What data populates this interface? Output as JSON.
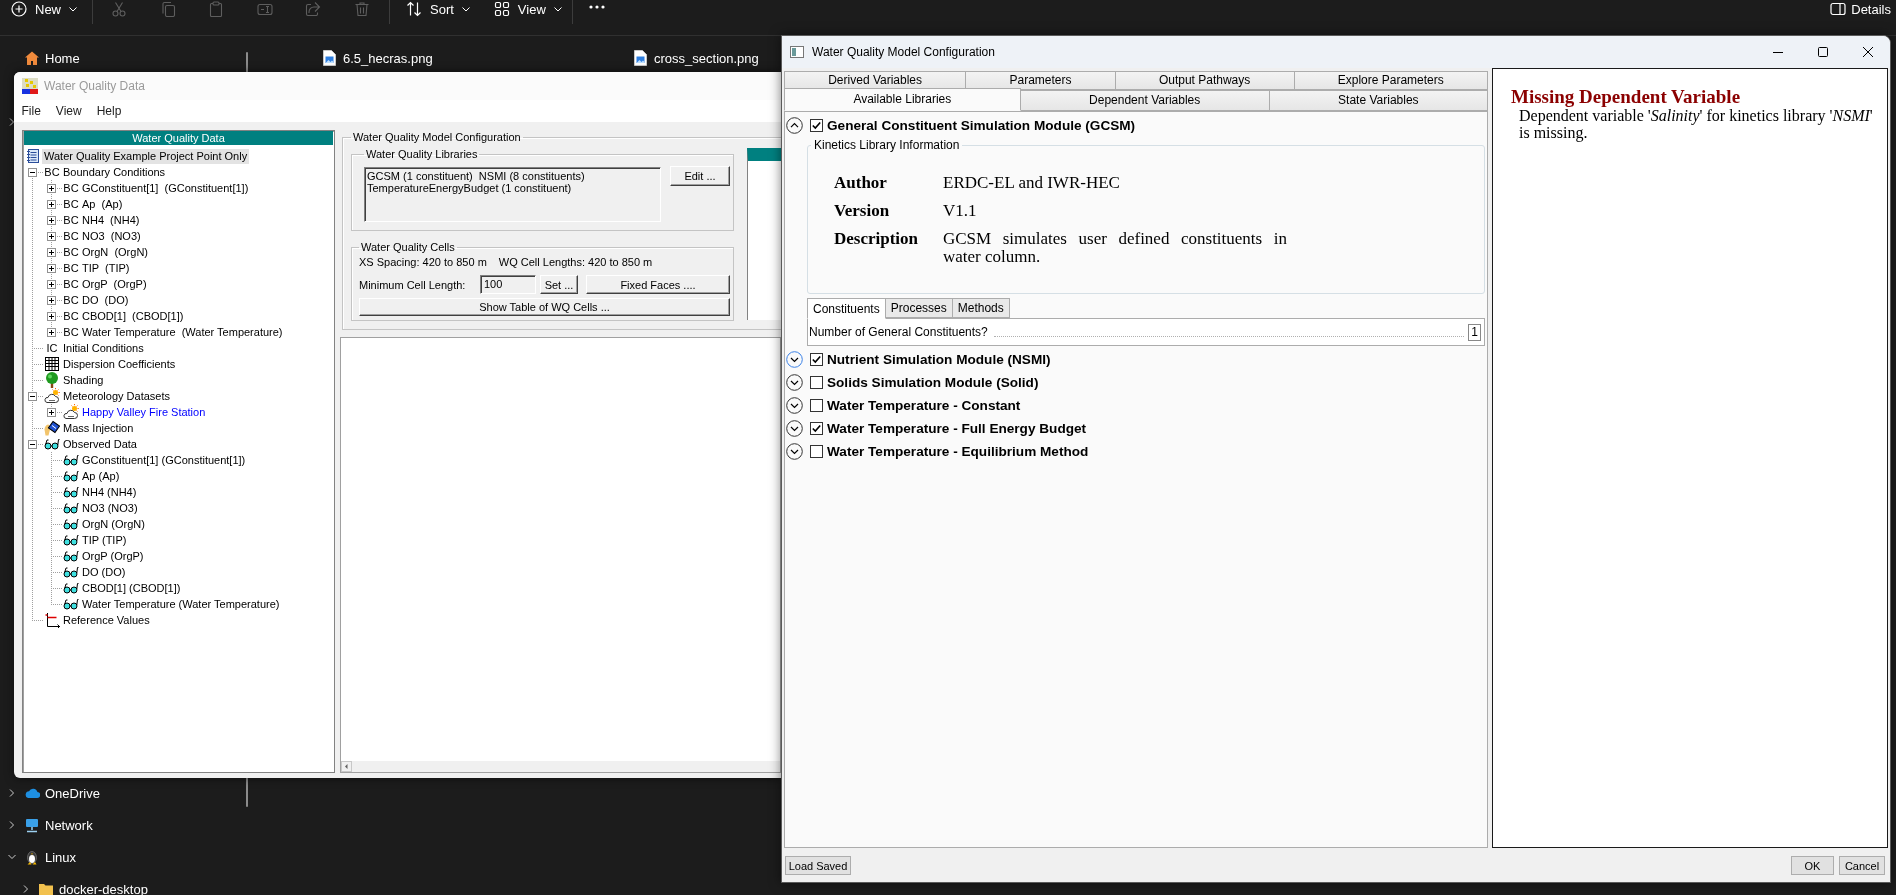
{
  "explorer": {
    "toolbar": {
      "new": "New",
      "actions": [
        {
          "kind": "cut",
          "disabled": true
        },
        {
          "kind": "copy",
          "disabled": true
        },
        {
          "kind": "paste",
          "disabled": true
        },
        {
          "kind": "rename",
          "disabled": true
        },
        {
          "kind": "share",
          "disabled": true
        },
        {
          "kind": "delete",
          "disabled": true
        }
      ],
      "sort": "Sort",
      "view": "View",
      "details": "Details"
    },
    "nav_top": [
      {
        "kind": "home",
        "label": "Home"
      },
      {
        "expanded": false
      }
    ],
    "nav_bottom": [
      {
        "kind": "cloud",
        "label": "OneDrive",
        "expanded": false
      },
      {
        "kind": "network",
        "label": "Network",
        "expanded": false
      },
      {
        "kind": "linux",
        "label": "Linux",
        "expanded": true,
        "children": [
          {
            "kind": "folder",
            "label": "docker-desktop",
            "expanded": false
          }
        ]
      }
    ],
    "files": [
      {
        "name": "6.5_hecras.png"
      },
      {
        "name": "cross_section.png"
      }
    ]
  },
  "wq_window": {
    "title": "Water Quality Data",
    "menu": [
      "File",
      "View",
      "Help"
    ],
    "tree_header": "Water Quality Data",
    "tree": {
      "kind": "project",
      "label": "Water Quality Example Project Point Only",
      "selected": true,
      "children": [
        {
          "kind": "tag",
          "tag": "BC",
          "label": "Boundary Conditions",
          "selected": false,
          "expanded": true,
          "children": [
            {
              "kind": "tag",
              "tag": "BC",
              "label": "GConstituent[1]  (GConstituent[1])",
              "selected": false,
              "expanded": false
            },
            {
              "kind": "tag",
              "tag": "BC",
              "label": "Ap  (Ap)",
              "selected": false,
              "expanded": false
            },
            {
              "kind": "tag",
              "tag": "BC",
              "label": "NH4  (NH4)",
              "selected": false,
              "expanded": false
            },
            {
              "kind": "tag",
              "tag": "BC",
              "label": "NO3  (NO3)",
              "selected": false,
              "expanded": false
            },
            {
              "kind": "tag",
              "tag": "BC",
              "label": "OrgN  (OrgN)",
              "selected": false,
              "expanded": false
            },
            {
              "kind": "tag",
              "tag": "BC",
              "label": "TIP  (TIP)",
              "selected": false,
              "expanded": false
            },
            {
              "kind": "tag",
              "tag": "BC",
              "label": "OrgP  (OrgP)",
              "selected": false,
              "expanded": false
            },
            {
              "kind": "tag",
              "tag": "BC",
              "label": "DO  (DO)",
              "selected": false,
              "expanded": false
            },
            {
              "kind": "tag",
              "tag": "BC",
              "label": "CBOD[1]  (CBOD[1])",
              "selected": false,
              "expanded": false
            },
            {
              "kind": "tag",
              "tag": "BC",
              "label": "Water Temperature  (Water Temperature)",
              "selected": false,
              "expanded": false
            }
          ]
        },
        {
          "kind": "tag",
          "tag": "IC",
          "label": "Initial Conditions",
          "selected": false
        },
        {
          "kind": "dispersion",
          "label": "Dispersion Coefficients",
          "selected": false
        },
        {
          "kind": "shading",
          "label": "Shading",
          "selected": false
        },
        {
          "kind": "weather",
          "label": "Meteorology Datasets",
          "selected": false,
          "expanded": true,
          "children": [
            {
              "kind": "weather",
              "label": "Happy Valley Fire Station",
              "selected": false,
              "expanded": false,
              "active": true
            }
          ]
        },
        {
          "kind": "injection",
          "label": "Mass Injection",
          "selected": false
        },
        {
          "kind": "observed",
          "label": "Observed Data",
          "selected": false,
          "expanded": true,
          "children": [
            {
              "kind": "observed",
              "label": "GConstituent[1] (GConstituent[1])",
              "selected": false
            },
            {
              "kind": "observed",
              "label": "Ap (Ap)",
              "selected": false
            },
            {
              "kind": "observed",
              "label": "NH4 (NH4)",
              "selected": false
            },
            {
              "kind": "observed",
              "label": "NO3 (NO3)",
              "selected": false
            },
            {
              "kind": "observed",
              "label": "OrgN (OrgN)",
              "selected": false
            },
            {
              "kind": "observed",
              "label": "TIP (TIP)",
              "selected": false
            },
            {
              "kind": "observed",
              "label": "OrgP (OrgP)",
              "selected": false
            },
            {
              "kind": "observed",
              "label": "DO (DO)",
              "selected": false
            },
            {
              "kind": "observed",
              "label": "CBOD[1] (CBOD[1])",
              "selected": false
            },
            {
              "kind": "observed",
              "label": "Water Temperature (Water Temperature)",
              "selected": false
            }
          ]
        },
        {
          "kind": "reference",
          "label": "Reference Values",
          "selected": false
        }
      ]
    },
    "config": {
      "title": "Water Quality Model Configuration",
      "libraries": {
        "title": "Water Quality Libraries",
        "lines": [
          "GCSM (1 constituent)  NSMI (8 constituents)",
          "TemperatureEnergyBudget (1 constituent)"
        ],
        "edit_button": "Edit ..."
      },
      "cells": {
        "title": "Water Quality Cells",
        "xs_spacing": "XS Spacing: 420 to 850 m",
        "cell_lengths": "WQ Cell Lengths: 420 to 850 m",
        "min_length_label": "Minimum Cell Length:",
        "min_length_value": "100",
        "set_button": "Set ...",
        "fixed_faces_button": "Fixed Faces ....",
        "table_button": "Show Table of WQ Cells ..."
      }
    }
  },
  "dialog": {
    "title": "Water Quality Model Configuration",
    "tab_rows": [
      [
        {
          "label": "Derived Variables",
          "selected": false
        },
        {
          "label": "Parameters",
          "selected": false
        },
        {
          "label": "Output Pathways",
          "selected": false
        },
        {
          "label": "Explore Parameters",
          "selected": false
        }
      ],
      [
        {
          "label": "Available Libraries",
          "selected": true
        },
        {
          "label": "Dependent Variables",
          "selected": false
        },
        {
          "label": "State Variables",
          "selected": false
        }
      ]
    ],
    "modules": [
      {
        "label": "General Constituent Simulation Module (GCSM)",
        "checked": true,
        "expanded": true,
        "focused": false,
        "info": {
          "title": "Kinetics Library Information",
          "fields": [
            {
              "label": "Author",
              "value": "ERDC-EL and IWR-HEC"
            },
            {
              "label": "Version",
              "value": "V1.1"
            },
            {
              "label": "Description",
              "value": "GCSM simulates user defined constituents in water column."
            }
          ],
          "tabs": [
            {
              "label": "Constituents",
              "selected": true
            },
            {
              "label": "Processes",
              "selected": false
            },
            {
              "label": "Methods",
              "selected": false
            }
          ],
          "question": "Number of General Constituents?",
          "answer": "1"
        }
      },
      {
        "label": "Nutrient Simulation Module (NSMI)",
        "checked": true,
        "expanded": false,
        "focused": true
      },
      {
        "label": "Solids Simulation Module (Solid)",
        "checked": false,
        "expanded": false,
        "focused": false
      },
      {
        "label": "Water Temperature - Constant",
        "checked": false,
        "expanded": false,
        "focused": false
      },
      {
        "label": "Water Temperature - Full Energy Budget",
        "checked": true,
        "expanded": false,
        "focused": false
      },
      {
        "label": "Water Temperature - Equilibrium Method",
        "checked": false,
        "expanded": false,
        "focused": false
      }
    ],
    "message": {
      "title": "Missing Dependent Variable",
      "body": "Dependent variable '*Salinity*' for kinetics library '*NSMI*' is missing."
    },
    "buttons": {
      "load_saved": "Load Saved",
      "ok": "OK",
      "cancel": "Cancel"
    }
  }
}
